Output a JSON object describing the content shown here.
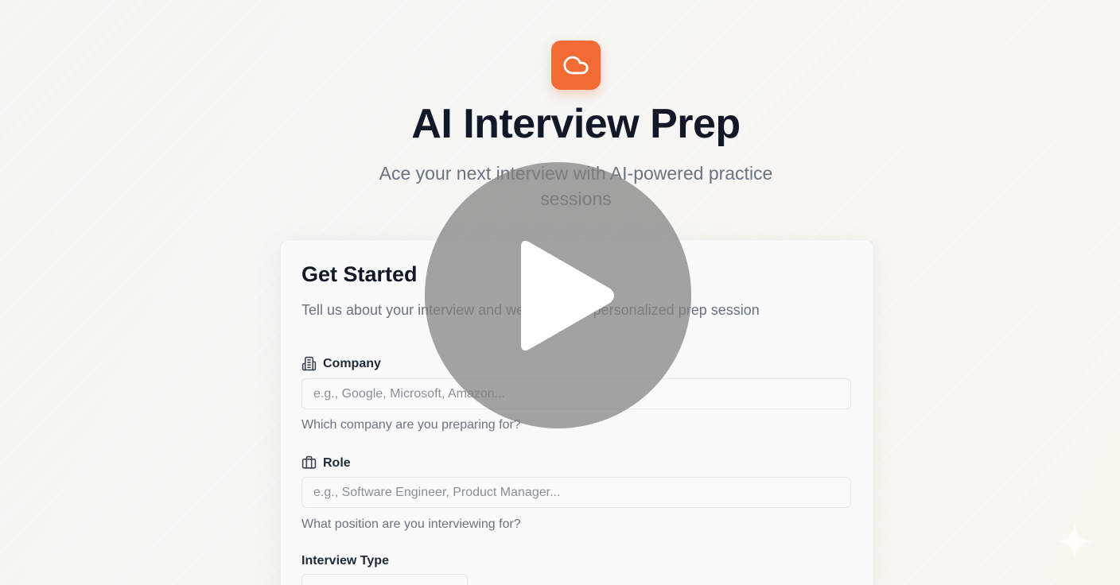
{
  "header": {
    "logo_icon": "cloud-icon",
    "title": "AI Interview Prep",
    "subtitle": "Ace your next interview with AI-powered practice sessions"
  },
  "form": {
    "title": "Get Started",
    "description": "Tell us about your interview and we'll create a personalized prep session",
    "company": {
      "icon": "building-icon",
      "label": "Company",
      "placeholder": "e.g., Google, Microsoft, Amazon...",
      "helper": "Which company are you preparing for?"
    },
    "role": {
      "icon": "briefcase-icon",
      "label": "Role",
      "placeholder": "e.g., Software Engineer, Product Manager...",
      "helper": "What position are you interviewing for?"
    },
    "interview_type": {
      "label": "Interview Type"
    }
  },
  "overlay": {
    "icon": "play-icon"
  },
  "colors": {
    "accent": "#f26a34",
    "title": "#111827",
    "muted": "#6b7280"
  }
}
